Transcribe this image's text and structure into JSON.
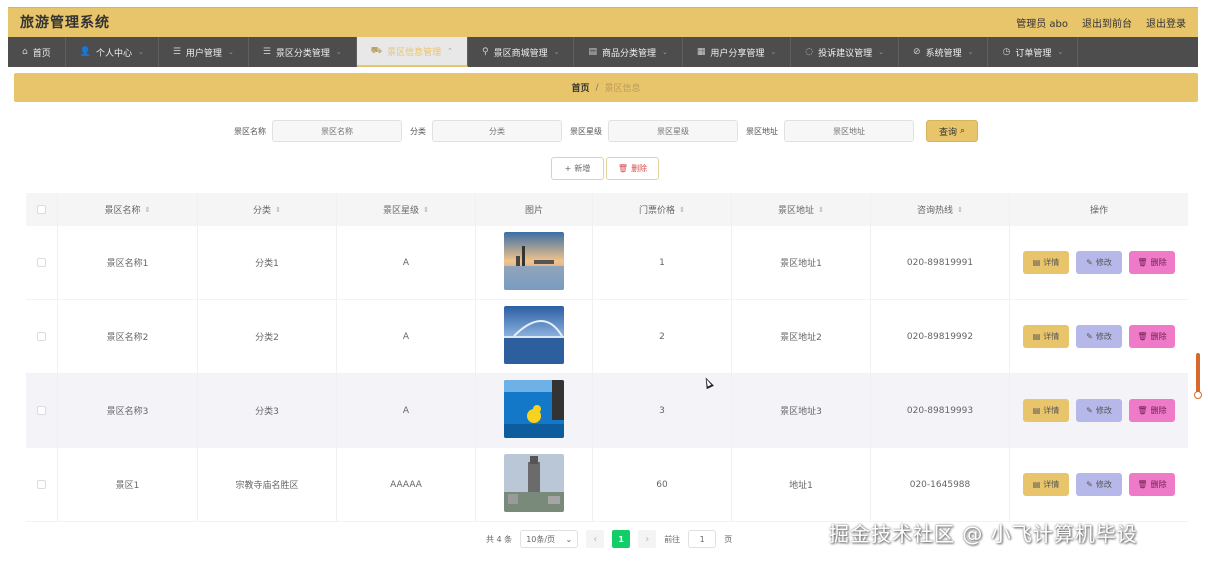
{
  "header": {
    "title": "旅游管理系统",
    "links": [
      "管理员 abo",
      "退出到前台",
      "退出登录"
    ]
  },
  "nav": {
    "items": [
      {
        "label": "首页",
        "icon": "home-icon",
        "glyph": "⌂",
        "chev": ""
      },
      {
        "label": "个人中心",
        "icon": "user-icon",
        "glyph": "👤",
        "chev": "⌄"
      },
      {
        "label": "用户管理",
        "icon": "list-icon",
        "glyph": "☰",
        "chev": "⌄"
      },
      {
        "label": "景区分类管理",
        "icon": "list-icon",
        "glyph": "☰",
        "chev": "⌄"
      },
      {
        "label": "景区信息管理",
        "icon": "truck-icon",
        "glyph": "⛟",
        "chev": "⌃"
      },
      {
        "label": "景区商城管理",
        "icon": "pin-icon",
        "glyph": "⚲",
        "chev": "⌄"
      },
      {
        "label": "商品分类管理",
        "icon": "doc-icon",
        "glyph": "▤",
        "chev": "⌄"
      },
      {
        "label": "用户分享管理",
        "icon": "briefcase-icon",
        "glyph": "▦",
        "chev": "⌄"
      },
      {
        "label": "投诉建议管理",
        "icon": "clock-icon",
        "glyph": "◌",
        "chev": "⌄"
      },
      {
        "label": "系统管理",
        "icon": "gear-icon",
        "glyph": "⊘",
        "chev": "⌄"
      },
      {
        "label": "订单管理",
        "icon": "clock-icon",
        "glyph": "◷",
        "chev": "⌄"
      }
    ],
    "active_index": 4
  },
  "breadcrumb": {
    "home": "首页",
    "sep": "/",
    "current": "景区信息"
  },
  "search": {
    "fields": [
      {
        "label": "景区名称",
        "placeholder": "景区名称"
      },
      {
        "label": "分类",
        "placeholder": "分类"
      },
      {
        "label": "景区星级",
        "placeholder": "景区星级"
      },
      {
        "label": "景区地址",
        "placeholder": "景区地址"
      }
    ],
    "button": "查询"
  },
  "actions": {
    "add": "新增",
    "delete": "删除"
  },
  "table": {
    "headers": [
      "景区名称",
      "分类",
      "景区星级",
      "图片",
      "门票价格",
      "景区地址",
      "咨询热线",
      "操作"
    ],
    "rows": [
      {
        "name": "景区名称1",
        "category": "分类1",
        "star": "A",
        "price": "1",
        "address": "景区地址1",
        "phone": "020-89819991",
        "image": "city-sunset"
      },
      {
        "name": "景区名称2",
        "category": "分类2",
        "star": "A",
        "price": "2",
        "address": "景区地址2",
        "phone": "020-89819992",
        "image": "bridge-sea"
      },
      {
        "name": "景区名称3",
        "category": "分类3",
        "star": "A",
        "price": "3",
        "address": "景区地址3",
        "phone": "020-89819993",
        "image": "pool-duck"
      },
      {
        "name": "景区1",
        "category": "宗教寺庙名胜区",
        "star": "AAAAA",
        "price": "60",
        "address": "地址1",
        "phone": "020-1645988",
        "image": "tower-city"
      }
    ],
    "row_actions": {
      "detail": "详情",
      "edit": "修改",
      "remove": "删除"
    }
  },
  "pagination": {
    "total": "共 4 条",
    "page_size": "10条/页",
    "current_page": "1",
    "goto_label": "前往",
    "goto_value": "1",
    "goto_suffix": "页"
  },
  "watermark": "掘金技术社区 @ 小飞计算机毕设",
  "colors": {
    "accent": "#e8c56b",
    "nav_bg": "#4d4d4d",
    "edit": "#b7b8ea",
    "remove": "#ef7ac7",
    "page_active": "#13ce66"
  }
}
